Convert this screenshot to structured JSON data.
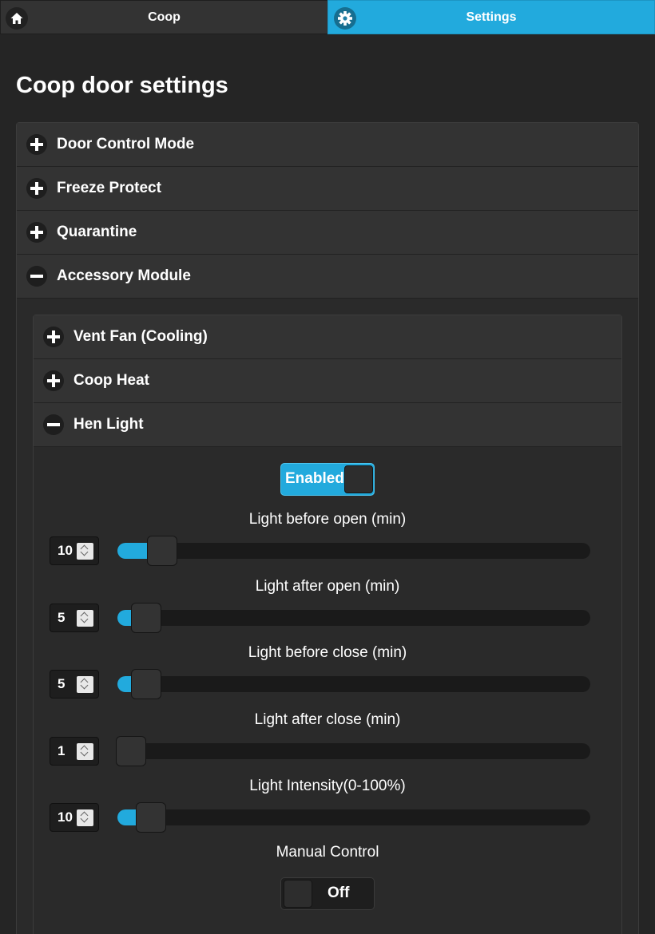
{
  "tabs": [
    {
      "label": "Coop",
      "icon": "home-icon",
      "active": false
    },
    {
      "label": "Settings",
      "icon": "gear-icon",
      "active": true
    }
  ],
  "page_title": "Coop door settings",
  "sections": [
    {
      "label": "Door Control Mode",
      "expanded": false
    },
    {
      "label": "Freeze Protect",
      "expanded": false
    },
    {
      "label": "Quarantine",
      "expanded": false
    },
    {
      "label": "Accessory Module",
      "expanded": true
    }
  ],
  "accessory": {
    "subsections": [
      {
        "label": "Vent Fan (Cooling)",
        "expanded": false
      },
      {
        "label": "Coop Heat",
        "expanded": false
      },
      {
        "label": "Hen Light",
        "expanded": true
      }
    ],
    "hen_light": {
      "enabled_toggle": {
        "label": "Enabled",
        "on": true
      },
      "sliders": [
        {
          "label": "Light before open (min)",
          "value": "10",
          "fraction": 0.07
        },
        {
          "label": "Light after open (min)",
          "value": "5",
          "fraction": 0.035
        },
        {
          "label": "Light before close (min)",
          "value": "5",
          "fraction": 0.035
        },
        {
          "label": "Light after close (min)",
          "value": "1",
          "fraction": 0.0
        },
        {
          "label": "Light Intensity(0-100%)",
          "value": "10",
          "fraction": 0.045
        }
      ],
      "manual_control": {
        "label": "Manual Control",
        "toggle_label": "Off",
        "on": false
      }
    }
  },
  "colors": {
    "accent": "#22aadd",
    "background": "#252525",
    "panel": "#333333"
  }
}
